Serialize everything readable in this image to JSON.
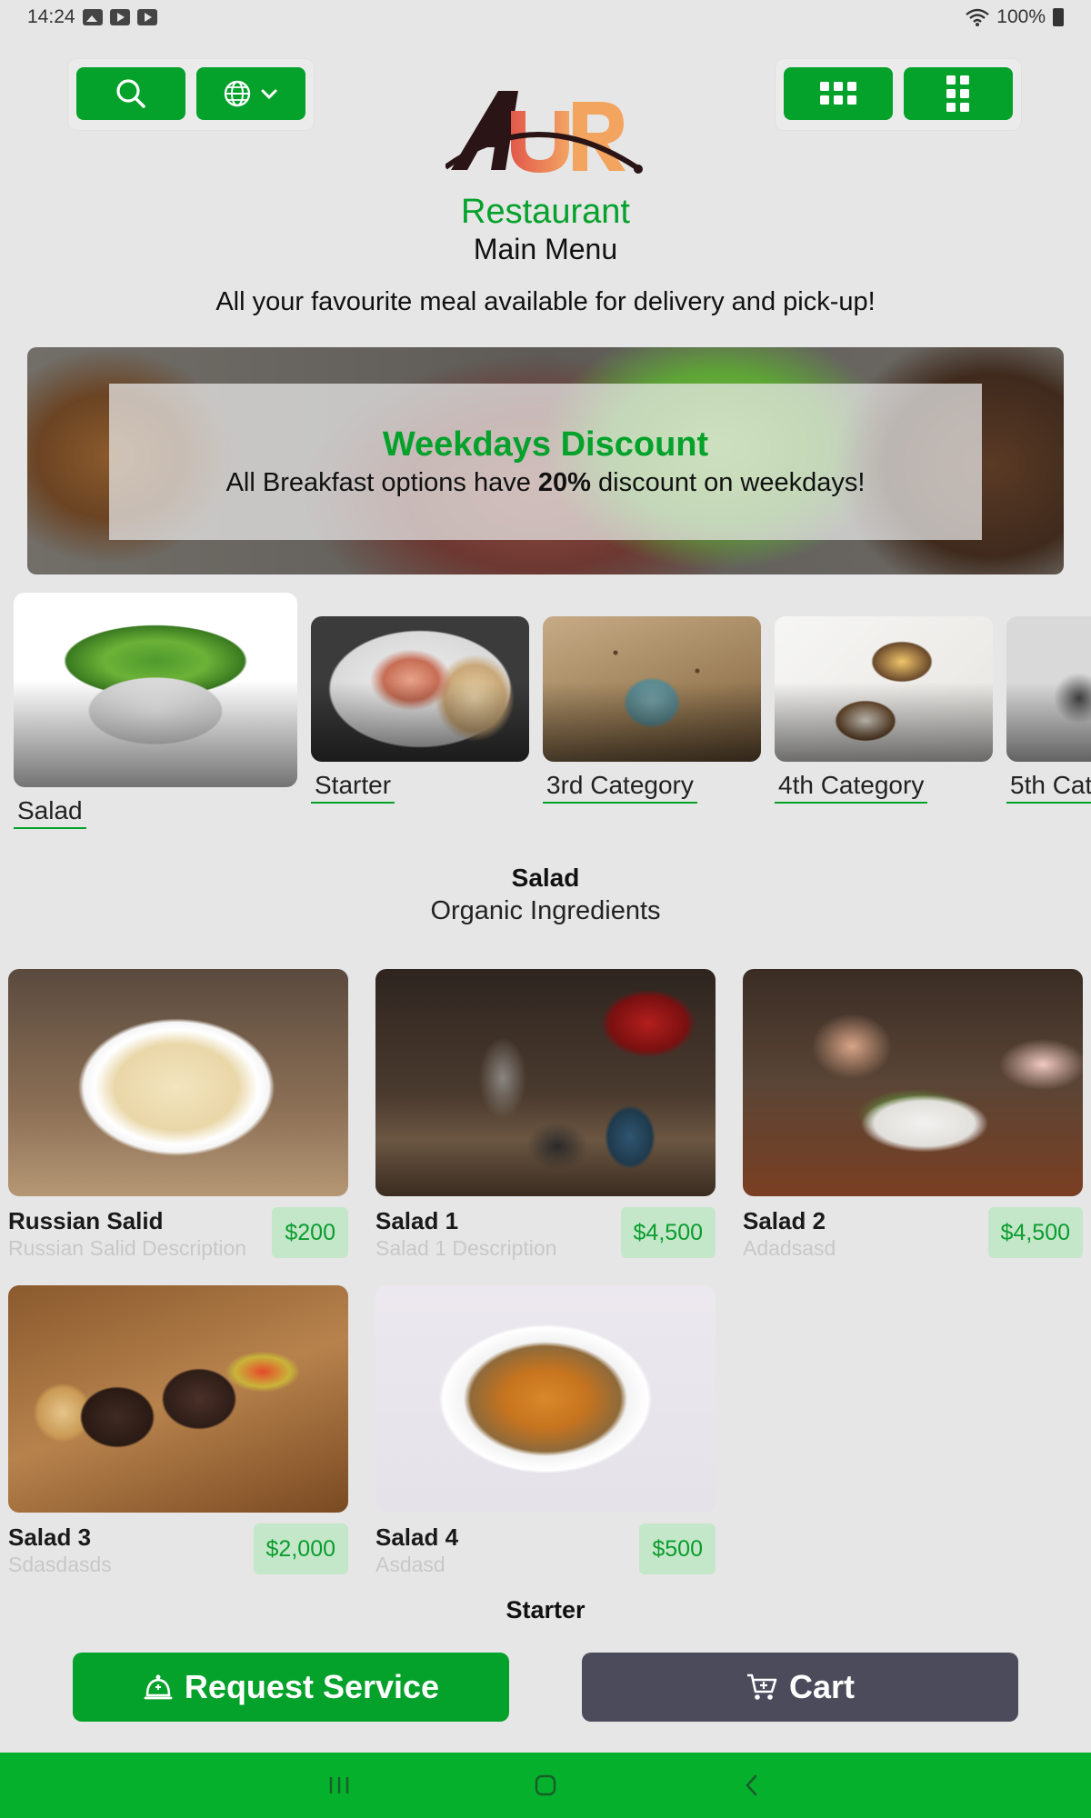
{
  "status_bar": {
    "time": "14:24",
    "battery": "100%"
  },
  "brand": {
    "name": "Restaurant",
    "menu_title": "Main Menu",
    "tagline": "All your favourite meal available for delivery and pick-up!"
  },
  "banner": {
    "title": "Weekdays Discount",
    "text_before": "All Breakfast options have ",
    "highlight": "20%",
    "text_after": " discount on weekdays!"
  },
  "categories": [
    {
      "label": "Salad",
      "selected": true
    },
    {
      "label": "Starter"
    },
    {
      "label": "3rd Category"
    },
    {
      "label": "4th Category"
    },
    {
      "label": "5th Cat"
    }
  ],
  "section": {
    "title": "Salad",
    "subtitle": "Organic Ingredients"
  },
  "items": [
    {
      "name": "Russian Salid",
      "description": "Russian Salid Description",
      "price": "$200"
    },
    {
      "name": "Salad 1",
      "description": "Salad 1 Description",
      "price": "$4,500"
    },
    {
      "name": "Salad 2",
      "description": "Adadsasd",
      "price": "$4,500"
    },
    {
      "name": "Salad 3",
      "description": "Sdasdasds",
      "price": "$2,000"
    },
    {
      "name": "Salad 4",
      "description": "Asdasd",
      "price": "$500"
    }
  ],
  "next_section": {
    "title": "Starter"
  },
  "actions": {
    "request_service": "Request Service",
    "cart": "Cart"
  },
  "colors": {
    "accent": "#04a12b",
    "price_bg": "#c5e7c9",
    "cart_bg": "#4b4b5c",
    "nav_bg": "#04b02c"
  },
  "icons": [
    "search-icon",
    "globe-icon",
    "chevron-down-icon",
    "grid-icon",
    "apps-icon",
    "bell-service-icon",
    "cart-icon",
    "recents-icon",
    "home-icon",
    "back-icon"
  ]
}
